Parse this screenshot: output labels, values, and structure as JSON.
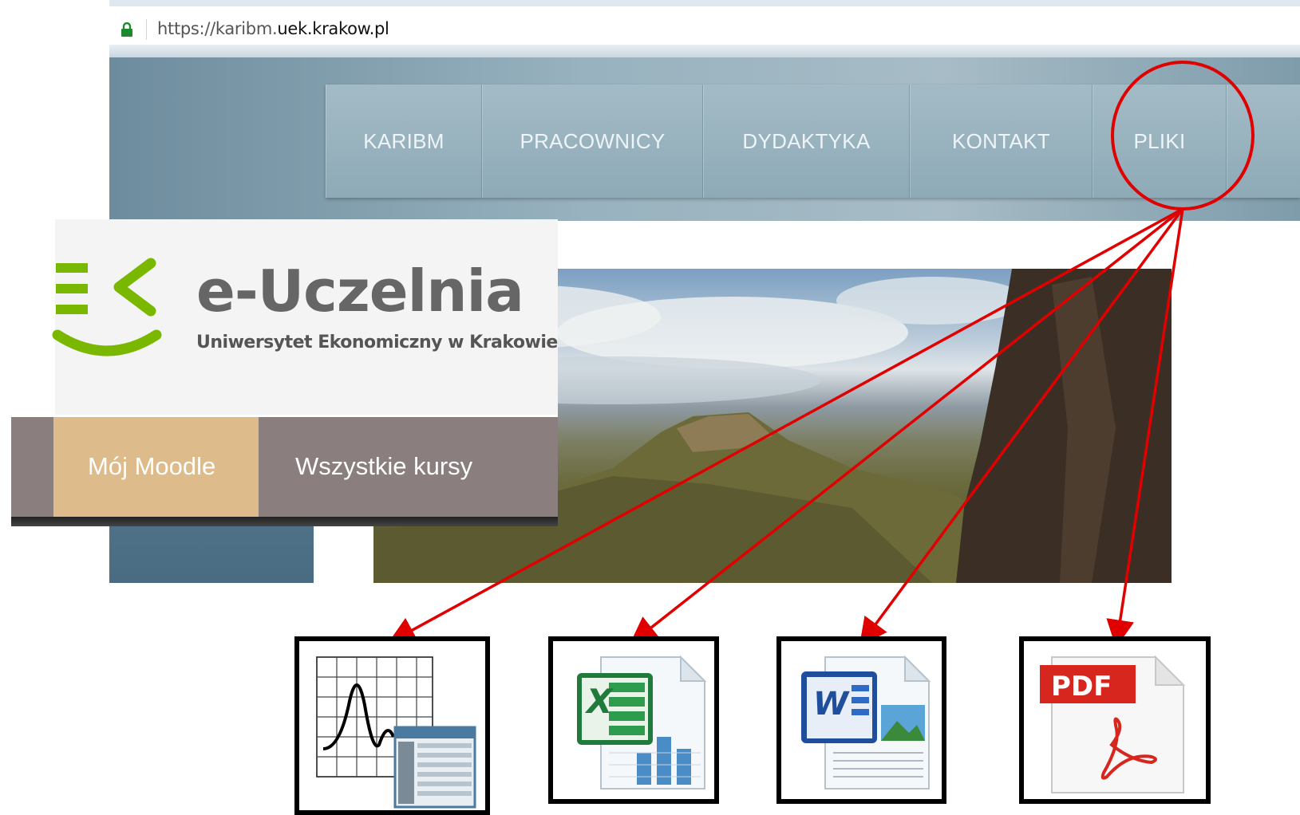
{
  "browser": {
    "url_prefix": "https://karibm.",
    "url_domain": "uek.krakow.pl",
    "lock_icon": "lock-icon"
  },
  "site_nav": {
    "items": [
      {
        "label": "KARIBM"
      },
      {
        "label": "PRACOWNICY"
      },
      {
        "label": "DYDAKTYKA"
      },
      {
        "label": "KONTAKT"
      },
      {
        "label": "PLIKI"
      }
    ]
  },
  "euczelnia": {
    "title": "e-Uczelnia",
    "subtitle": "Uniwersytet Ekonomiczny w Krakowie",
    "nav": [
      {
        "label": "Mój Moodle"
      },
      {
        "label": "Wszystkie kursy"
      }
    ]
  },
  "files": [
    {
      "icon": "data-analysis-file-icon"
    },
    {
      "icon": "excel-file-icon"
    },
    {
      "icon": "word-file-icon"
    },
    {
      "icon": "pdf-file-icon",
      "badge": "PDF"
    }
  ],
  "colors": {
    "highlight": "#e00000",
    "moodle_active": "#ddbb8a",
    "moodle_bar": "#8a7f7e",
    "logo_green": "#7ab800"
  }
}
